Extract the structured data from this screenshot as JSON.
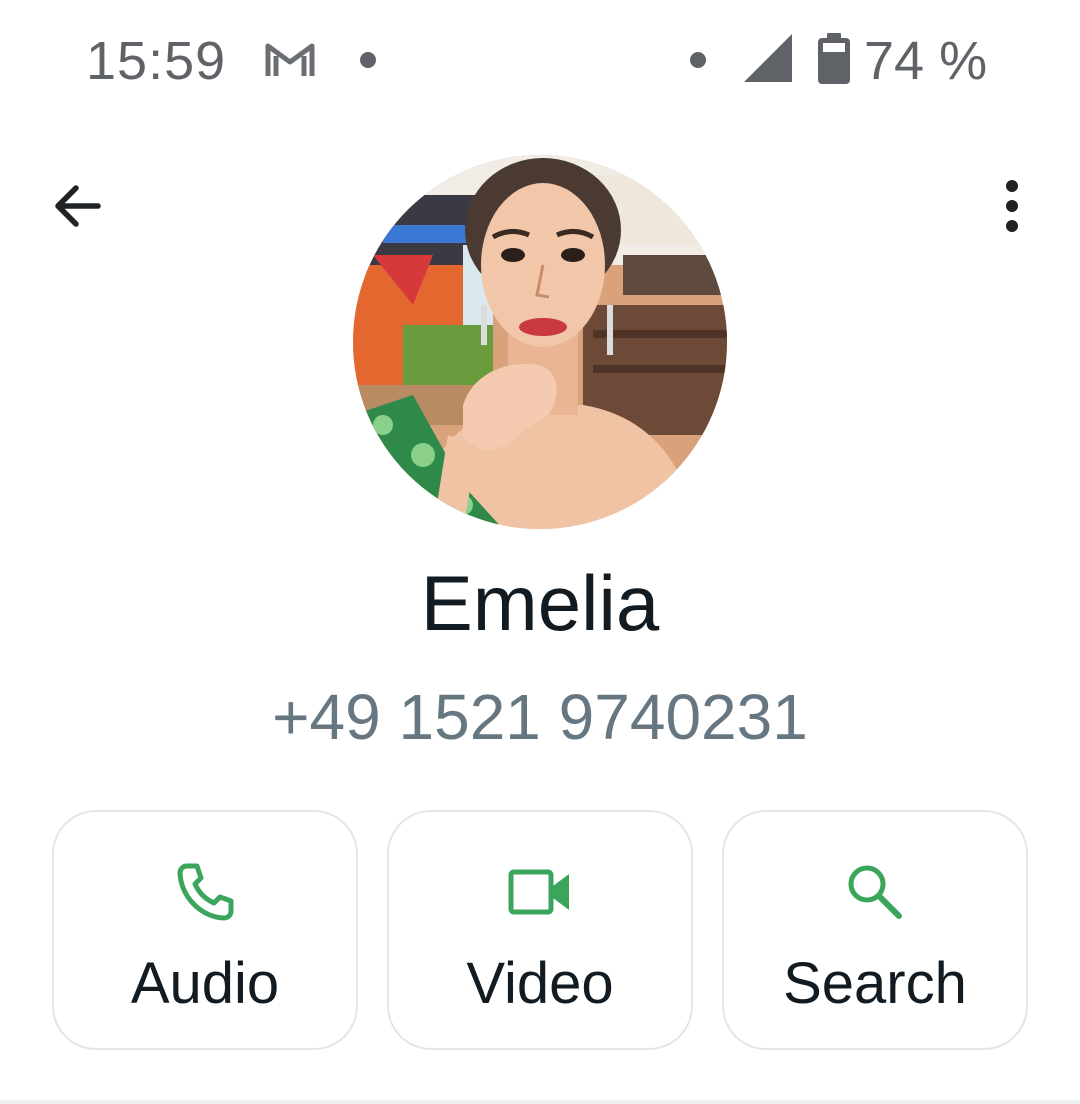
{
  "status_bar": {
    "time": "15:59",
    "notification_icon": "gmail-icon",
    "battery_percent": "74 %",
    "signal_icon": "signal-icon",
    "battery_icon": "battery-icon"
  },
  "app_bar": {
    "back_icon": "back-arrow-icon",
    "menu_icon": "more-vert-icon"
  },
  "contact": {
    "name": "Emelia",
    "phone": "+49 1521 9740231"
  },
  "actions": [
    {
      "label": "Audio",
      "icon": "phone-icon"
    },
    {
      "label": "Video",
      "icon": "video-camera-icon"
    },
    {
      "label": "Search",
      "icon": "search-icon"
    }
  ],
  "colors": {
    "accent": "#3ca55c",
    "text_primary": "#111b21",
    "text_secondary": "#667781",
    "status_gray": "#5f6368",
    "card_border": "#e3e6e8"
  }
}
